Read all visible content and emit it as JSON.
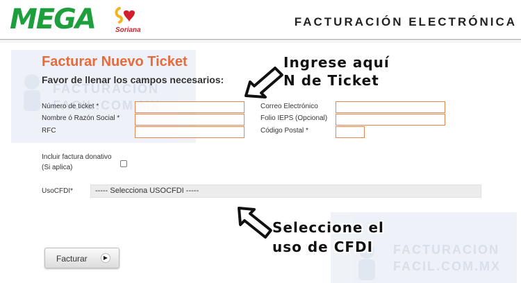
{
  "header": {
    "brand": "MEGA",
    "sub_brand": "Soriana",
    "title": "FACTURACIÓN ELECTRÓNICA"
  },
  "watermark": {
    "line1": "FACTURACION",
    "line2": "FACIL.COM.MX"
  },
  "form": {
    "title": "Facturar Nuevo Ticket",
    "subtitle": "Favor de llenar los campos necesarios:",
    "fields": {
      "ticket": {
        "label": "Número de ticket *",
        "value": ""
      },
      "nombre": {
        "label": "Nombre ó Razón Social *",
        "value": ""
      },
      "rfc": {
        "label": "RFC",
        "value": ""
      },
      "correo": {
        "label": "Correo Electrónico",
        "value": ""
      },
      "folio": {
        "label": "Folio IEPS (Opcional)",
        "value": ""
      },
      "cp": {
        "label": "Código Postal *",
        "value": ""
      }
    },
    "donativo": {
      "label_line1": "Incluir factura donativo",
      "label_line2": "(Si aplica)",
      "checked": false
    },
    "usocfdi": {
      "label": "UsoCFDI*",
      "selected": "----- Selecciona USOCFDI -----"
    },
    "submit_label": "Facturar",
    "submit_icon": "play-icon"
  },
  "annotations": {
    "ticket_line1": "Ingrese aquí",
    "ticket_line2": "N de Ticket",
    "cfdi_line1": "Seleccione el",
    "cfdi_line2": "uso de CFDI"
  },
  "colors": {
    "brand_green": "#1e9f3e",
    "soriana_red": "#d21f2d",
    "title_orange": "#e8693a",
    "input_border": "#e8854e"
  }
}
